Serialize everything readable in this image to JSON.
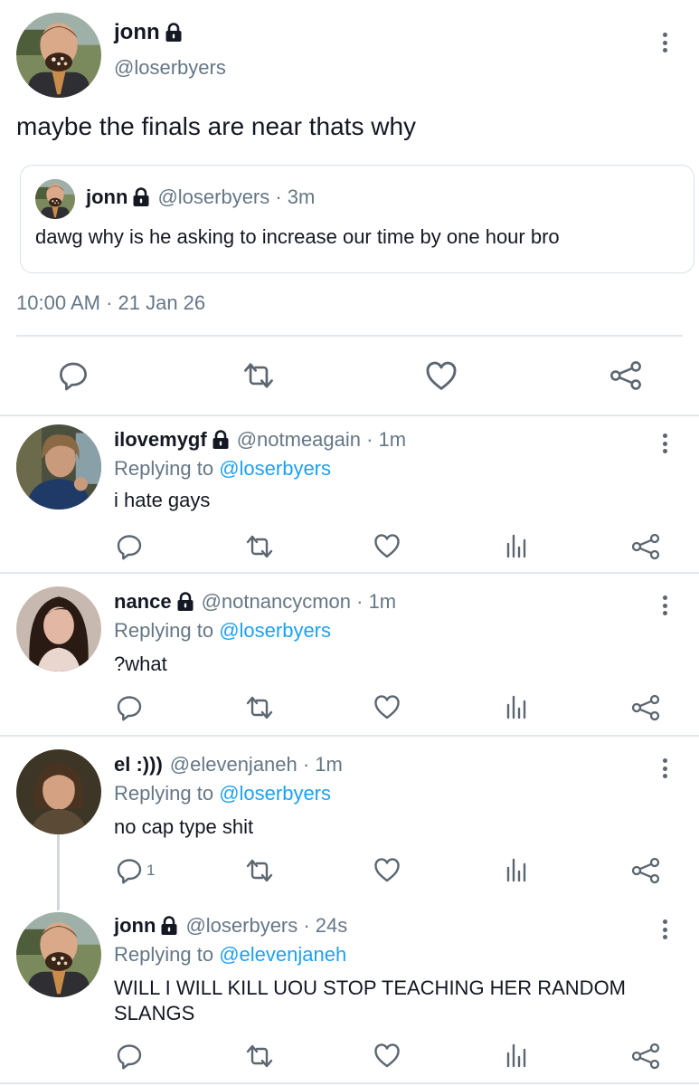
{
  "main_tweet": {
    "name": "jonn",
    "handle": "@loserbyers",
    "text": "maybe the finals are near thats why",
    "quote": {
      "name": "jonn",
      "handle_time": "@loserbyers · 3m",
      "text": "dawg why is he asking to increase our time by one hour bro"
    },
    "timestamp": "10:00 AM · 21 Jan 26"
  },
  "replies": [
    {
      "name": "ilovemygf",
      "locked": true,
      "handle_time": "@notmeagain · 1m",
      "replying_prefix": "Replying to ",
      "replying_to": "@loserbyers",
      "text": "i hate gays",
      "reply_count": ""
    },
    {
      "name": "nance",
      "locked": true,
      "handle_time": "@notnancycmon · 1m",
      "replying_prefix": "Replying to ",
      "replying_to": "@loserbyers",
      "text": "?what",
      "reply_count": ""
    },
    {
      "name": "el :)))",
      "locked": false,
      "handle_time": "@elevenjaneh · 1m",
      "replying_prefix": "Replying to ",
      "replying_to": "@loserbyers",
      "text": "no cap type shit",
      "reply_count": "1"
    },
    {
      "name": "jonn",
      "locked": true,
      "handle_time": "@loserbyers · 24s",
      "replying_prefix": "Replying to ",
      "replying_to": "@elevenjaneh",
      "text": "WILL I WILL KILL UOU STOP TEACHING HER RANDOM SLANGS",
      "reply_count": ""
    }
  ],
  "icons": {
    "reply": "reply-icon",
    "retweet": "retweet-icon",
    "like": "heart-icon",
    "stats": "stats-icon",
    "share": "share-icon",
    "lock": "lock-icon",
    "more": "more-vertical-icon"
  },
  "colors": {
    "text": "#141823",
    "muted": "#657786",
    "link": "#1da1f2",
    "divider": "#e1e8ed",
    "icon": "#5b6670"
  }
}
